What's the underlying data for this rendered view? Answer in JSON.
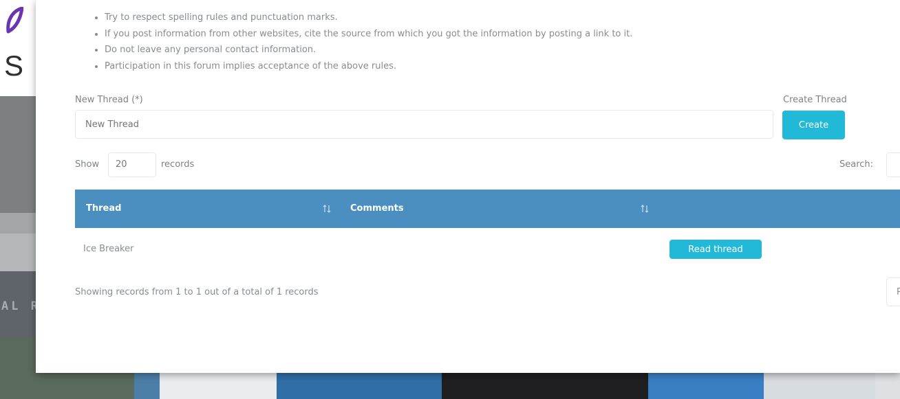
{
  "background": {
    "page_letter": "S",
    "ribbon_text": "AL R"
  },
  "rules": [
    "Try to respect spelling rules and punctuation marks.",
    "If you post information from other websites, cite the source from which you got the information by posting a link to it.",
    "Do not leave any personal contact information.",
    "Participation in this forum implies acceptance of the above rules."
  ],
  "new_thread": {
    "label": "New Thread (*)",
    "placeholder": "New Thread",
    "value": ""
  },
  "create_thread": {
    "label": "Create Thread",
    "button_label": "Create"
  },
  "table_controls": {
    "show_label": "Show",
    "length_value": "20",
    "records_label": "records",
    "search_label": "Search:"
  },
  "table": {
    "columns": [
      "Thread",
      "Comments"
    ],
    "rows": [
      {
        "thread": "Ice Breaker",
        "comments": "",
        "action_label": "Read thread"
      }
    ]
  },
  "footer": {
    "info": "Showing records from 1 to 1 out of a total of 1 records",
    "prev_label": "Pre"
  },
  "colors": {
    "header_bg": "#4b8fc0",
    "button_bg": "#22b8d8",
    "logo_purple": "#6a35b0"
  },
  "icons": {
    "sort": "sort-arrows-icon",
    "logo": "leaf-logo-icon"
  }
}
